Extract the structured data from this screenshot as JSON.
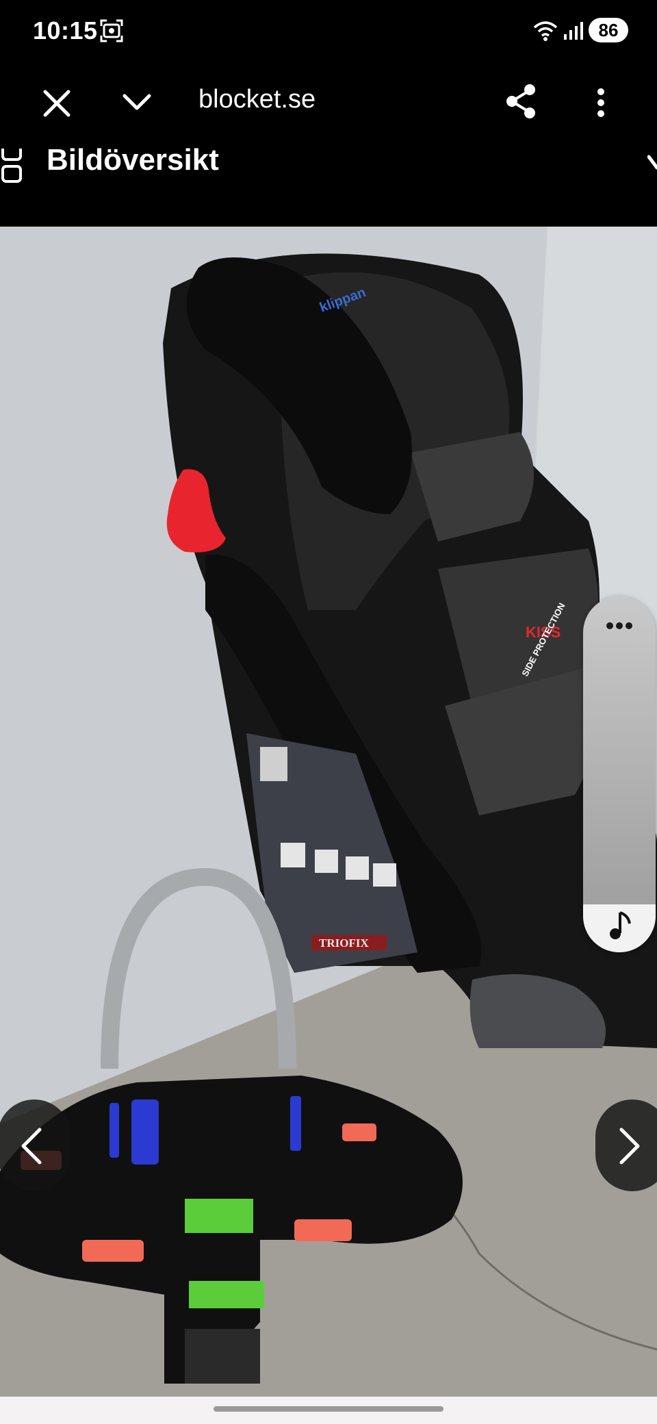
{
  "status": {
    "time": "10:15",
    "battery": "86",
    "icons": [
      "screenshot-icon",
      "wifi-icon",
      "signal-icon"
    ]
  },
  "browser": {
    "url": "blocket.se",
    "icons": [
      "close-icon",
      "chevron-down-icon",
      "share-icon",
      "more-vert-icon"
    ]
  },
  "gallery": {
    "title": "Bildöversikt",
    "icons": [
      "grid-icon",
      "chevron-right-icon"
    ]
  },
  "photo": {
    "brand_label": "klippan",
    "seat_label_1": "KISS",
    "seat_label_2": "SIDE PROTECTION",
    "base_label": "TRIOFIX"
  },
  "nav": {
    "icons": [
      "chevron-left-icon",
      "chevron-right-icon"
    ]
  },
  "panel": {
    "icons": [
      "more-horiz-icon",
      "music-note-icon"
    ]
  },
  "colors": {
    "background": "#000000",
    "text": "#ffffff",
    "seat_red": "#e8252e",
    "clip_blue": "#2b3bd1",
    "clip_green": "#5ccd3a"
  }
}
